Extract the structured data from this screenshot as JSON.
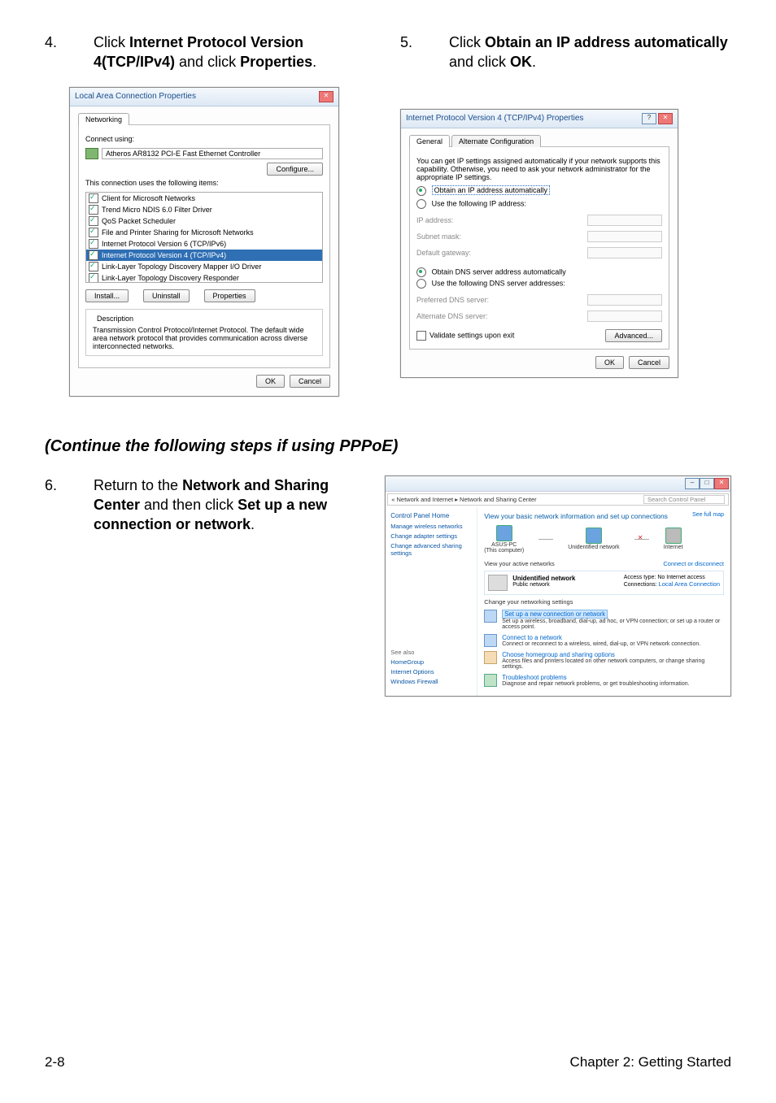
{
  "step4": {
    "num": "4.",
    "pre": "Click ",
    "bold1": "Internet Protocol Version 4(TCP/IPv4)",
    "mid": " and click ",
    "bold2": "Properties",
    "end": "."
  },
  "step5": {
    "num": "5.",
    "pre": "Click ",
    "bold1": "Obtain an IP address automatically",
    "mid": " and click ",
    "bold2": "OK",
    "end": "."
  },
  "step6": {
    "num": "6.",
    "pre": "Return to the ",
    "bold1": "Network and Sharing Center",
    "mid": " and then click ",
    "bold2": "Set up a new connection or network",
    "end": "."
  },
  "continue": "(Continue the following steps if using PPPoE)",
  "lac": {
    "title": "Local Area Connection Properties",
    "tab": "Networking",
    "connectUsing": "Connect using:",
    "adapter": "Atheros AR8132 PCI-E Fast Ethernet Controller",
    "configure": "Configure...",
    "usesItems": "This connection uses the following items:",
    "items": [
      "Client for Microsoft Networks",
      "Trend Micro NDIS 6.0 Filter Driver",
      "QoS Packet Scheduler",
      "File and Printer Sharing for Microsoft Networks",
      "Internet Protocol Version 6 (TCP/IPv6)",
      "Internet Protocol Version 4 (TCP/IPv4)",
      "Link-Layer Topology Discovery Mapper I/O Driver",
      "Link-Layer Topology Discovery Responder"
    ],
    "install": "Install...",
    "uninstall": "Uninstall",
    "properties": "Properties",
    "descLabel": "Description",
    "desc": "Transmission Control Protocol/Internet Protocol. The default wide area network protocol that provides communication across diverse interconnected networks.",
    "ok": "OK",
    "cancel": "Cancel"
  },
  "ipv4": {
    "title": "Internet Protocol Version 4 (TCP/IPv4) Properties",
    "tab1": "General",
    "tab2": "Alternate Configuration",
    "intro": "You can get IP settings assigned automatically if your network supports this capability. Otherwise, you need to ask your network administrator for the appropriate IP settings.",
    "optAuto": "Obtain an IP address automatically",
    "optUse": "Use the following IP address:",
    "ip": "IP address:",
    "subnet": "Subnet mask:",
    "gateway": "Default gateway:",
    "dnsAuto": "Obtain DNS server address automatically",
    "dnsUse": "Use the following DNS server addresses:",
    "pref": "Preferred DNS server:",
    "alt": "Alternate DNS server:",
    "validate": "Validate settings upon exit",
    "advanced": "Advanced...",
    "ok": "OK",
    "cancel": "Cancel"
  },
  "cp": {
    "crumb": "« Network and Internet ▸ Network and Sharing Center",
    "search": "Search Control Panel",
    "sideHome": "Control Panel Home",
    "side1": "Manage wireless networks",
    "side2": "Change adapter settings",
    "side3": "Change advanced sharing settings",
    "seeAlso": "See also",
    "homegroup": "HomeGroup",
    "iopt": "Internet Options",
    "wfw": "Windows Firewall",
    "h1": "View your basic network information and set up connections",
    "seeFull": "See full map",
    "pc": "ASUS-PC",
    "pcSub": "(This computer)",
    "unid": "Unidentified network",
    "inet": "Internet",
    "viewActive": "View your active networks",
    "conDisc": "Connect or disconnect",
    "netName": "Unidentified network",
    "netType": "Public network",
    "accessType": "Access type:",
    "accessVal": "No Internet access",
    "connections": "Connections:",
    "connVal": "Local Area Connection",
    "changeSettings": "Change your networking settings",
    "t1": "Set up a new connection or network",
    "d1": "Set up a wireless, broadband, dial-up, ad hoc, or VPN connection; or set up a router or access point.",
    "t2": "Connect to a network",
    "d2": "Connect or reconnect to a wireless, wired, dial-up, or VPN network connection.",
    "t3": "Choose homegroup and sharing options",
    "d3": "Access files and printers located on other network computers, or change sharing settings.",
    "t4": "Troubleshoot problems",
    "d4": "Diagnose and repair network problems, or get troubleshooting information."
  },
  "footer": {
    "left": "2-8",
    "right": "Chapter 2: Getting Started"
  }
}
